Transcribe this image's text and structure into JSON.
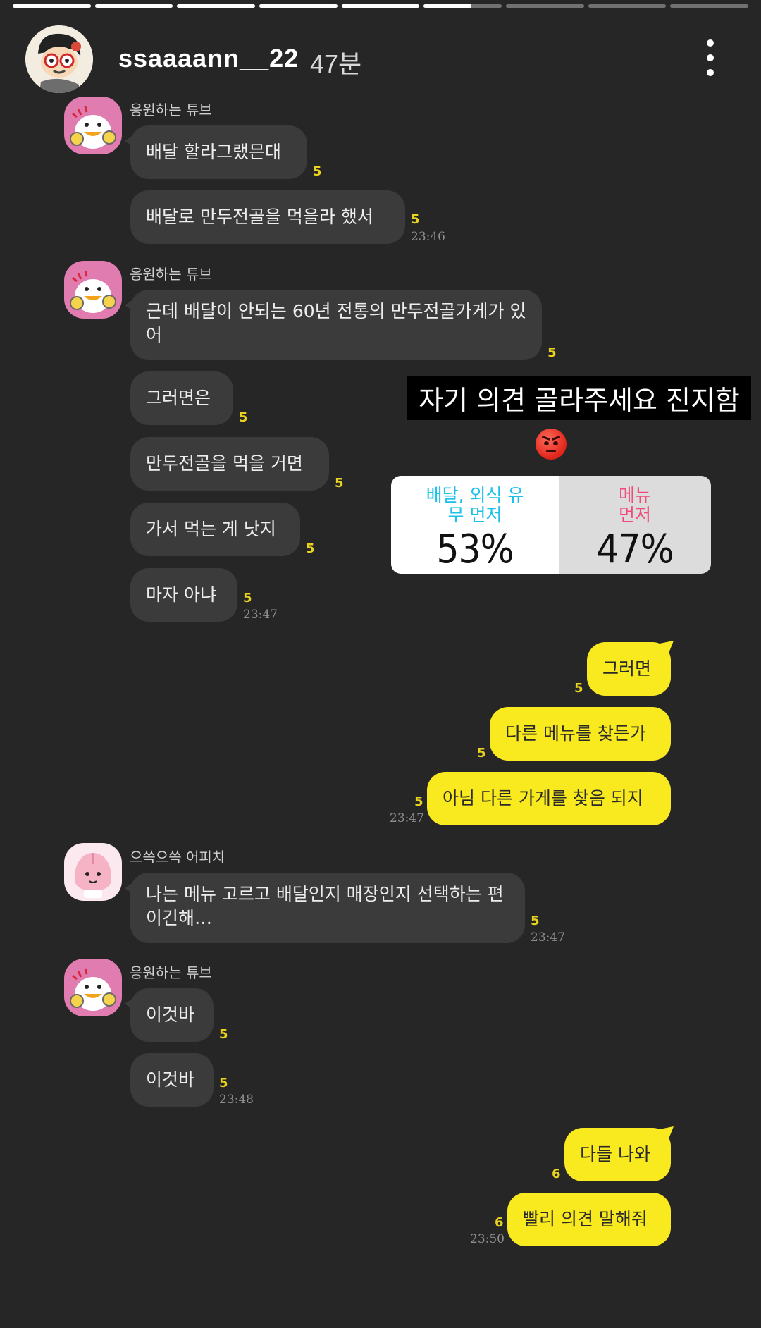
{
  "story": {
    "segments_total": 9,
    "current_segment": 6,
    "current_segment_progress": 0.6
  },
  "header": {
    "username": "ssaaaann__22",
    "time_ago": "47분",
    "more_icon": "more-vertical-icon"
  },
  "messages": [
    {
      "sender": "응원하는 튜브",
      "avatar": "tube-duck-avatar",
      "text": "배달 할라그랬믄대",
      "count": "5",
      "time": ""
    },
    {
      "sender": "",
      "text": "배달로 만두전골을 먹을라 했서",
      "count": "5",
      "time": "23:46"
    },
    {
      "sender": "응원하는 튜브",
      "avatar": "tube-duck-avatar",
      "text": "근데 배달이 안되는 60년 전통의 만두전골가게가 있어",
      "count": "5",
      "time": ""
    },
    {
      "sender": "",
      "text": "그러면은",
      "count": "5",
      "time": ""
    },
    {
      "sender": "",
      "text": "만두전골을 먹을 거면",
      "count": "5",
      "time": ""
    },
    {
      "sender": "",
      "text": "가서 먹는 게 낫지",
      "count": "5",
      "time": ""
    },
    {
      "sender": "",
      "text": "마자 아냐",
      "count": "5",
      "time": "23:47"
    },
    {
      "mine": true,
      "text": "그러면",
      "count": "5",
      "time": ""
    },
    {
      "mine": true,
      "text": "다른 메뉴를 찾든가",
      "count": "5",
      "time": ""
    },
    {
      "mine": true,
      "text": "아님 다른 가게를 찾음 되지",
      "count": "5",
      "time": "23:47"
    },
    {
      "sender": "으쓱으쓱 어피치",
      "avatar": "apeach-avatar",
      "text": "나는 메뉴 고르고 배달인지 매장인지 선택하는 편이긴해…",
      "count": "5",
      "time": "23:47"
    },
    {
      "sender": "응원하는 튜브",
      "avatar": "tube-duck-avatar",
      "text": "이것바",
      "count": "5",
      "time": ""
    },
    {
      "sender": "",
      "text": "이것바",
      "count": "5",
      "time": "23:48"
    },
    {
      "mine": true,
      "text": "다들 나와",
      "count": "6",
      "time": ""
    },
    {
      "mine": true,
      "text": "빨리 의견 말해줘",
      "count": "6",
      "time": "23:50"
    }
  ],
  "overlay": {
    "caption": "자기 의견 골라주세요 진지함",
    "emoji": "angry-face-icon"
  },
  "poll": {
    "option_a": {
      "label": "배달, 외식 유무 먼저",
      "percent": "53%",
      "color": "#1cc0e8",
      "fraction": 0.53
    },
    "option_b": {
      "label": "메뉴 먼저",
      "percent": "47%",
      "color": "#f24b7a",
      "fraction": 0.47
    }
  },
  "colors": {
    "background": "#262626",
    "their_bubble": "#3b3b3b",
    "my_bubble": "#f9e91f",
    "read_count": "#e8d21d"
  }
}
